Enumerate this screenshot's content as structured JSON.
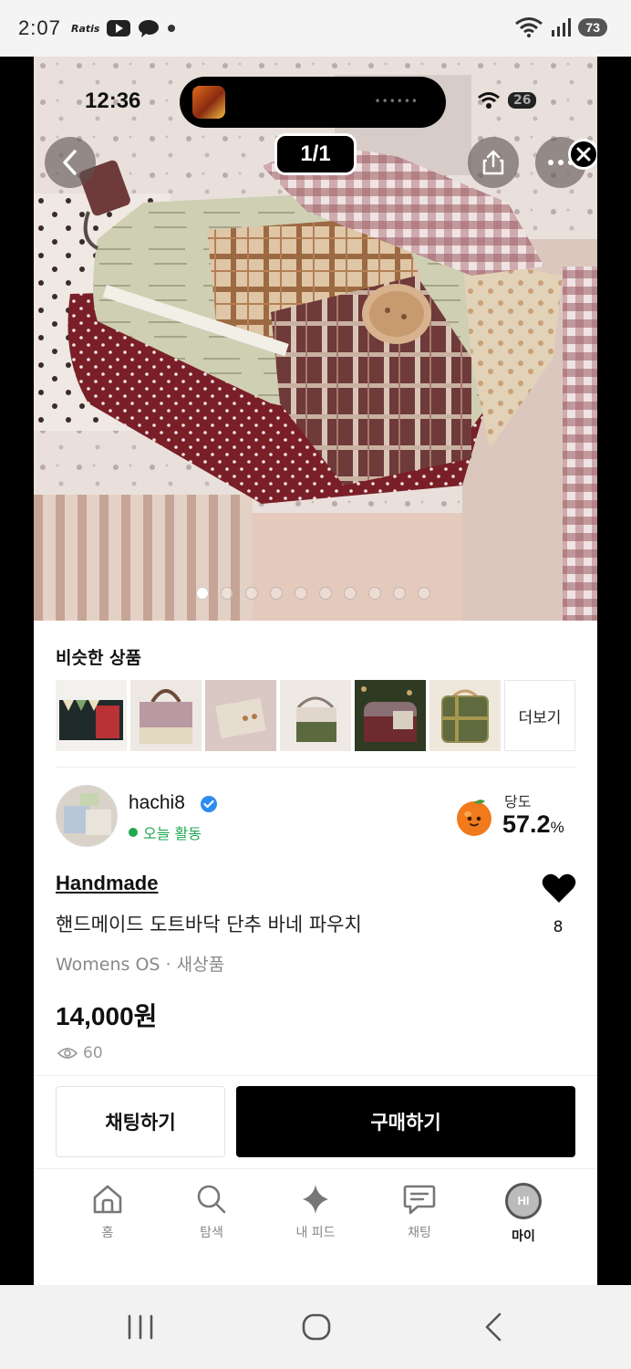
{
  "os_status": {
    "time": "2:07",
    "app_label": "Ratis",
    "battery": "73"
  },
  "inner_status": {
    "time": "12:36",
    "battery": "26"
  },
  "gallery": {
    "counter": "1/1",
    "total_dots": 10,
    "active_dot": 0
  },
  "similar": {
    "title": "비슷한 상품",
    "more_label": "더보기"
  },
  "seller": {
    "name": "hachi8",
    "activity": "오늘 활동",
    "dangdo_label": "당도",
    "dangdo_value": "57.2",
    "dangdo_unit": "%"
  },
  "product": {
    "shop": "Handmade",
    "title": "핸드메이드 도트바닥 단추 바네 파우치",
    "meta": "Womens OS · 새상품",
    "price": "14,000원",
    "views": "60",
    "likes": "8"
  },
  "actions": {
    "chat": "채팅하기",
    "buy": "구매하기"
  },
  "nav": {
    "home": "홈",
    "search": "탐색",
    "feed": "내 피드",
    "chat": "채팅",
    "my": "마이",
    "avatar_text": "HI"
  },
  "colors": {
    "accent_green": "#1fa84f",
    "verified_blue": "#2d8cf0",
    "primary_black": "#000000"
  }
}
